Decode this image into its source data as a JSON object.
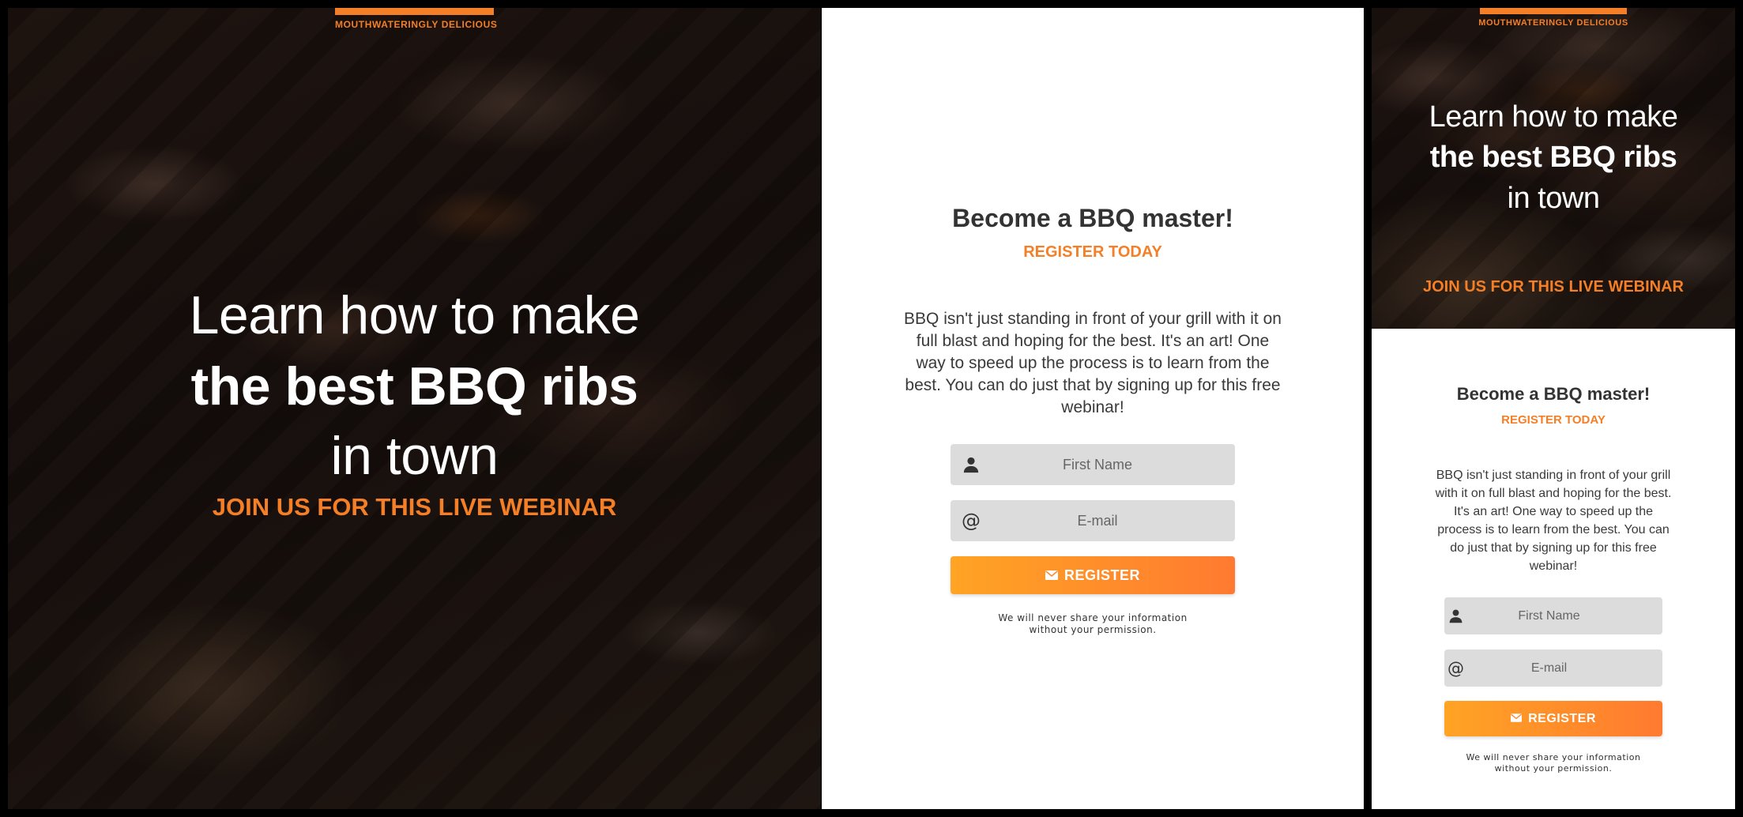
{
  "brand": {
    "tagline": "MOUTHWATERINGLY DELICIOUS",
    "accent_color": "#f47f26"
  },
  "hero": {
    "line1": "Learn how to make",
    "line2": "the best BBQ ribs",
    "line3": "in town",
    "subtitle": "JOIN US FOR THIS LIVE WEBINAR"
  },
  "form": {
    "title": "Become a BBQ master!",
    "subtitle": "REGISTER TODAY",
    "description": "BBQ isn't just standing in front of your grill with it on full blast and hoping for the best. It's an art! One way to speed up the process is to learn from the best. You can do just that by signing up for this free webinar!",
    "first_name_placeholder": "First Name",
    "first_name_icon": "user-icon",
    "email_placeholder": "E-mail",
    "email_icon": "at-icon",
    "email_icon_glyph": "@",
    "register_label": "REGISTER",
    "register_icon": "envelope-icon",
    "button_gradient": [
      "#ffa424",
      "#ff7a30"
    ],
    "privacy_line1": "We will never share your information",
    "privacy_line2": "without your permission."
  }
}
